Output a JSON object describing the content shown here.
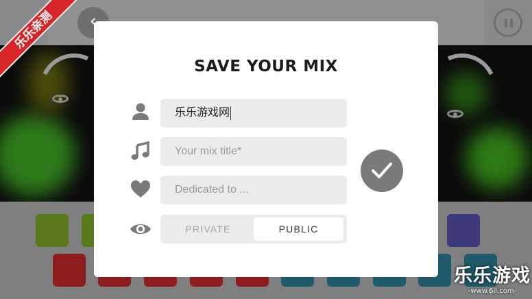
{
  "modal": {
    "title": "SAVE YOUR MIX",
    "fields": {
      "author": {
        "value": "乐乐游戏网",
        "icon": "person-icon"
      },
      "mix_title": {
        "placeholder": "Your mix title*",
        "icon": "music-note-icon"
      },
      "dedication": {
        "placeholder": "Dedicated to ...",
        "icon": "heart-icon"
      }
    },
    "visibility": {
      "icon": "eye-icon",
      "options": [
        "PRIVATE",
        "PUBLIC"
      ],
      "selected": "PUBLIC"
    },
    "confirm_icon": "checkmark-icon"
  },
  "nav": {
    "back_icon": "chevron-left-icon",
    "back_glyph": "‹",
    "pause_icon": "pause-icon"
  },
  "watermarks": {
    "corner_label": "乐乐亲测",
    "brand": "乐乐游戏",
    "url": "www.6ll.com"
  },
  "colors": {
    "overlay": "#7d7d7d",
    "modal_bg": "#ffffff",
    "field_bg": "#ececec",
    "icon_grey": "#7a7a7a",
    "watermark_red": "#d7252a"
  }
}
